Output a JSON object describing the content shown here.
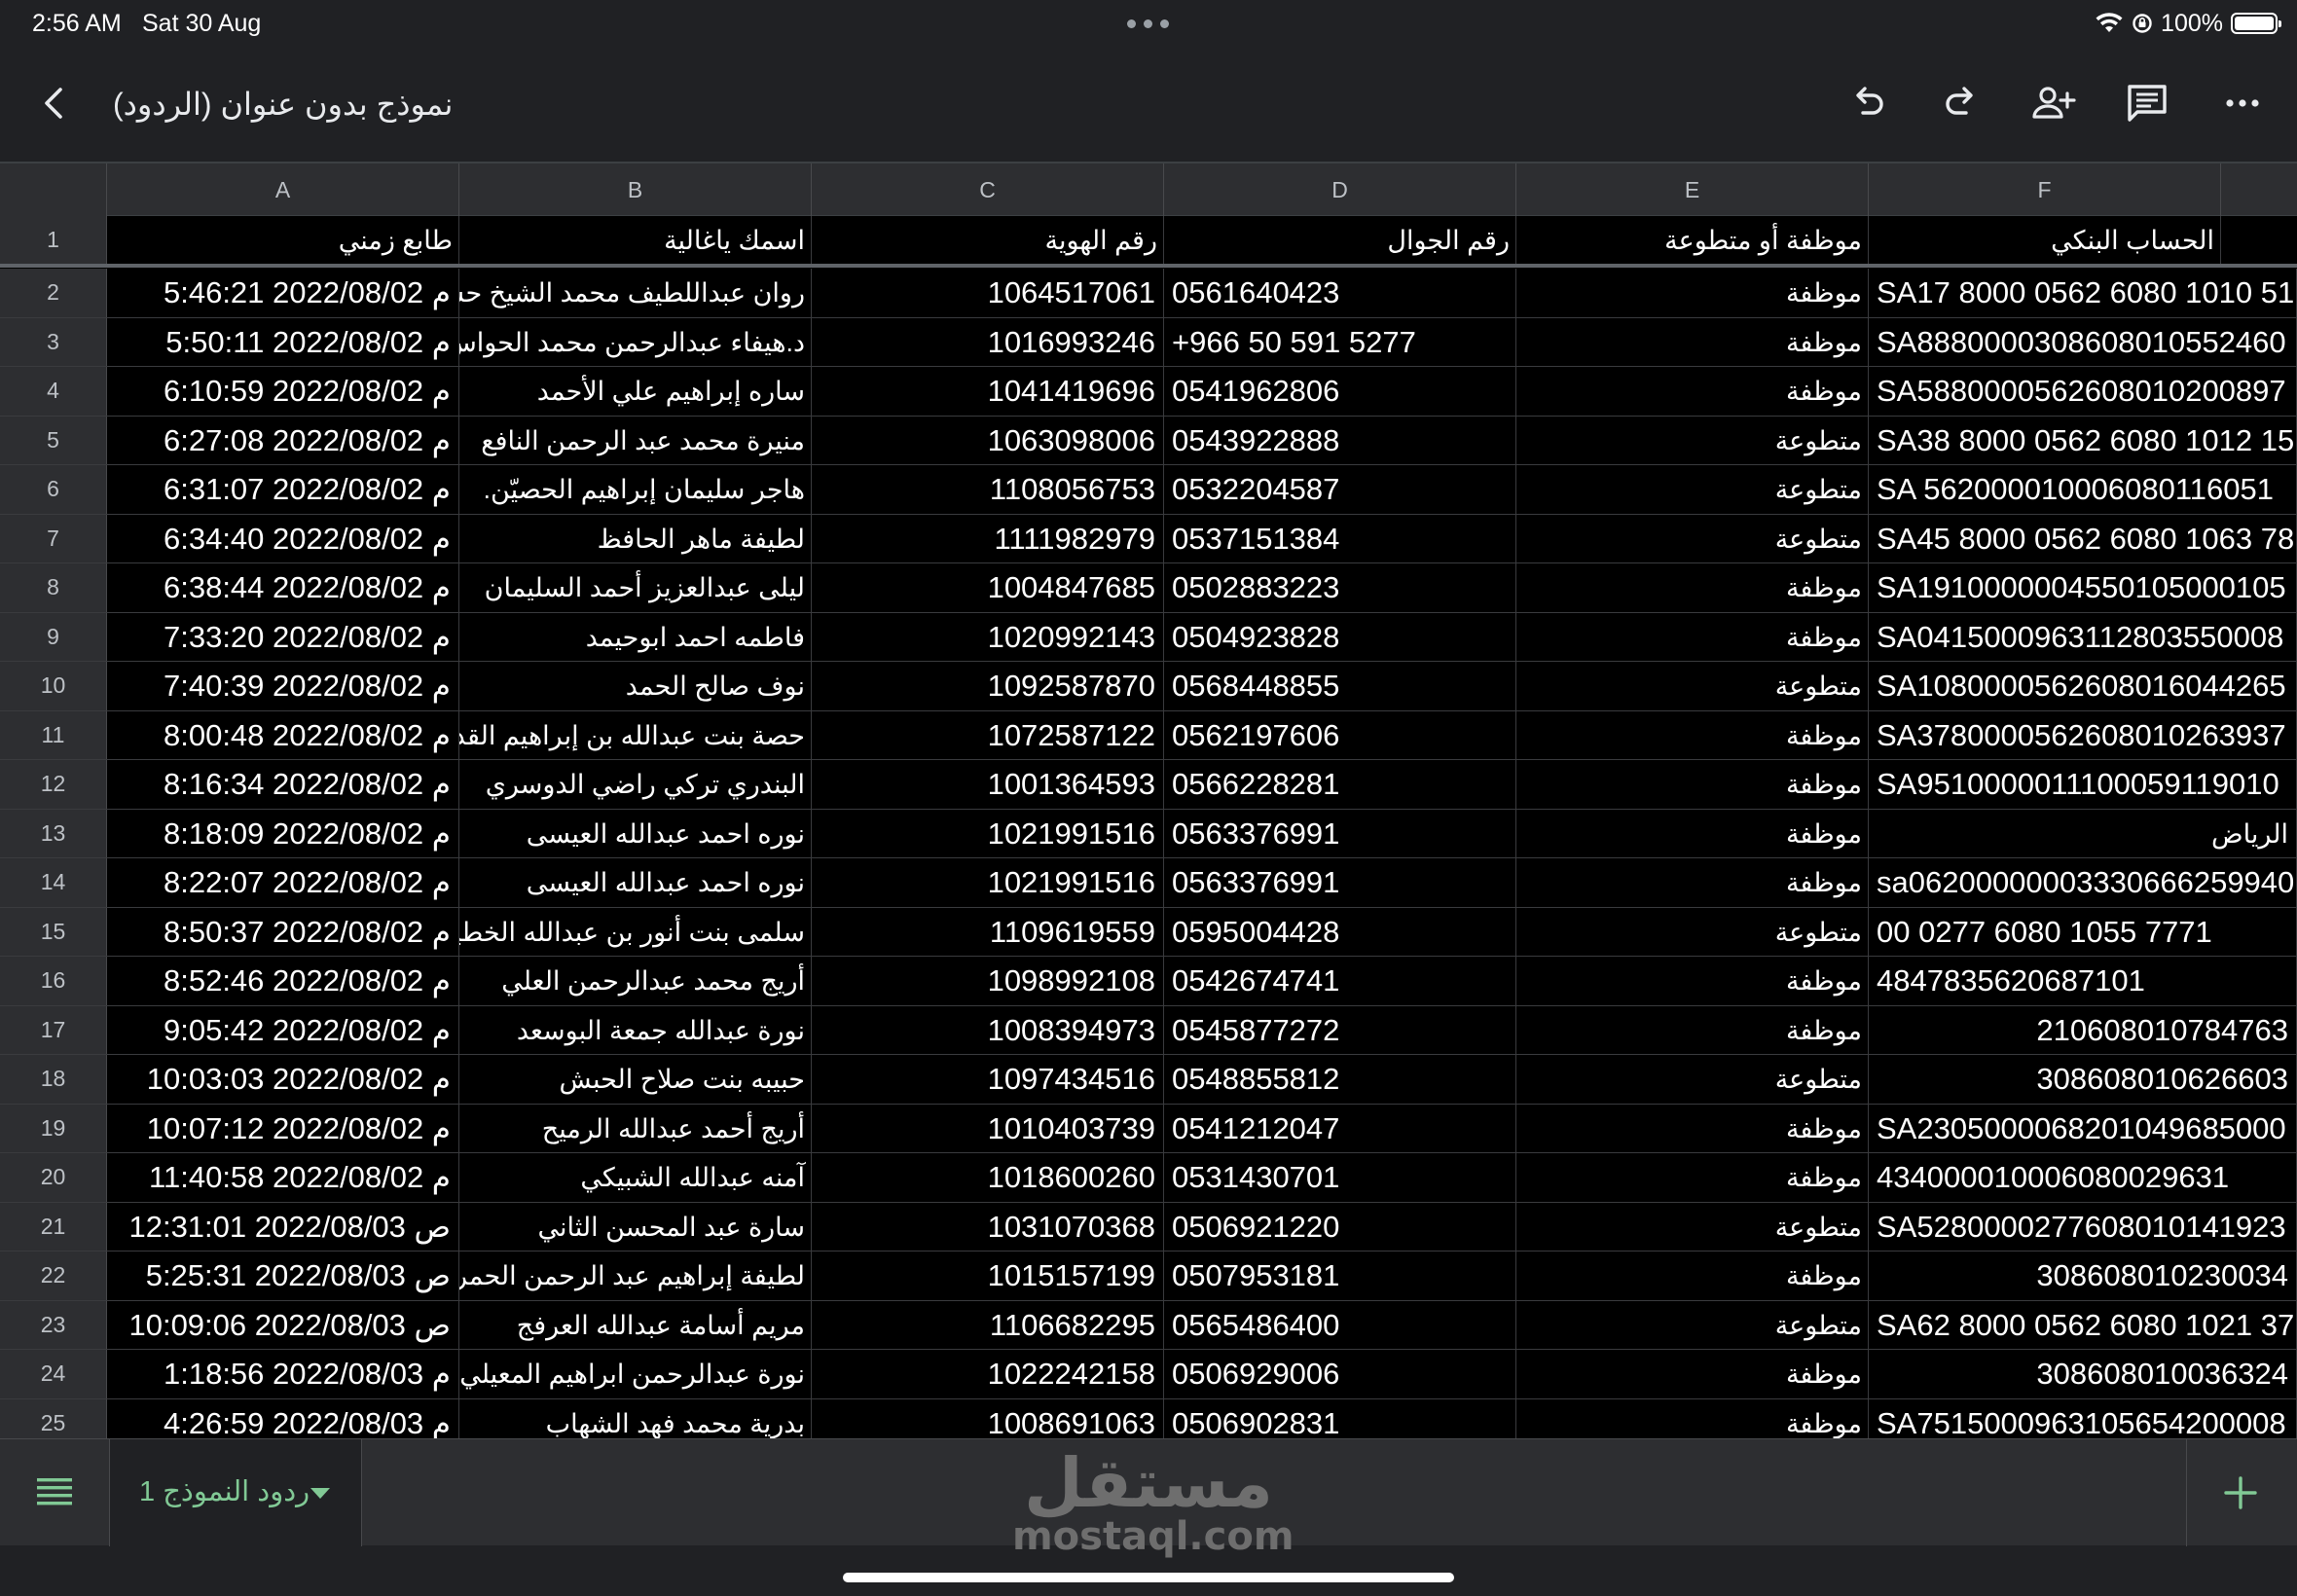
{
  "status": {
    "time": "2:56 AM",
    "date": "Sat 30 Aug",
    "battery": "100%",
    "battery_level": 1.0
  },
  "toolbar": {
    "title": "نموذج بدون عنوان (الردود)"
  },
  "columns": [
    "A",
    "B",
    "C",
    "D",
    "E",
    "F"
  ],
  "header": {
    "num": "1",
    "cells": [
      "طابع زمني",
      "اسمك ياغالية",
      "رقم الهوية",
      "رقم الجوال",
      "موظفة أو متطوعة",
      "الحساب البنكي"
    ]
  },
  "rows": [
    {
      "num": "2",
      "ts": "5:46:21 2022/08/02 م",
      "name": "روان عبداللطيف محمد الشيخ حسين",
      "id": "1064517061",
      "phone": "0561640423",
      "type": "موظفة",
      "acct": "SA17 8000 0562 6080 1010 51",
      "acct_align": "left"
    },
    {
      "num": "3",
      "ts": "5:50:11 2022/08/02 م",
      "name": "د.هيفاء عبدالرحمن محمد الحواس",
      "id": "1016993246",
      "phone": "+966 50 591 5277",
      "type": "موظفة",
      "acct": "SA8880000308608010552460",
      "acct_align": "left"
    },
    {
      "num": "4",
      "ts": "6:10:59 2022/08/02 م",
      "name": "ساره إبراهيم علي الأحمد",
      "id": "1041419696",
      "phone": "0541962806",
      "type": "موظفة",
      "acct": "SA5880000562608010200897",
      "acct_align": "left"
    },
    {
      "num": "5",
      "ts": "6:27:08 2022/08/02 م",
      "name": "منيرة محمد عبد الرحمن النافع",
      "id": "1063098006",
      "phone": "0543922888",
      "type": "متطوعة",
      "acct": "SA38 8000 0562 6080 1012 15",
      "acct_align": "left"
    },
    {
      "num": "6",
      "ts": "6:31:07 2022/08/02 م",
      "name": "هاجر سليمان إبراهيم الحصيّن.",
      "id": "1108056753",
      "phone": "0532204587",
      "type": "متطوعة",
      "acct": "SA 5620000100060801​16051",
      "acct_align": "left"
    },
    {
      "num": "7",
      "ts": "6:34:40 2022/08/02 م",
      "name": "لطيفة ماهر الحافظ",
      "id": "1111982979",
      "phone": "0537151384",
      "type": "متطوعة",
      "acct": "SA45 8000 0562 6080 1063 78",
      "acct_align": "left"
    },
    {
      "num": "8",
      "ts": "6:38:44 2022/08/02 م",
      "name": "ليلى عبدالعزيز أحمد السليمان",
      "id": "1004847685",
      "phone": "0502883223",
      "type": "موظفة",
      "acct": "SA1910000004550105000105",
      "acct_align": "left"
    },
    {
      "num": "9",
      "ts": "7:33:20 2022/08/02 م",
      "name": "فاطمه احمد ابوحيمد",
      "id": "1020992143",
      "phone": "0504923828",
      "type": "موظفة",
      "acct": "SA0415000963112803550008",
      "acct_align": "left"
    },
    {
      "num": "10",
      "ts": "7:40:39 2022/08/02 م",
      "name": "نوف صالح الحمد",
      "id": "1092587870",
      "phone": "0568448855",
      "type": "متطوعة",
      "acct": "SA1080000562608016044265",
      "acct_align": "left"
    },
    {
      "num": "11",
      "ts": "8:00:48 2022/08/02 م",
      "name": "حصة بنت عبدالله  بن إبراهيم القديم",
      "id": "1072587122",
      "phone": "0562197606",
      "type": "موظفة",
      "acct": "SA3780000562608010263937",
      "acct_align": "left"
    },
    {
      "num": "12",
      "ts": "8:16:34 2022/08/02 م",
      "name": "البندري تركي راضي الدوسري",
      "id": "1001364593",
      "phone": "0566228281",
      "type": "موظفة",
      "acct": "SA9510000011100059119010",
      "acct_align": "left"
    },
    {
      "num": "13",
      "ts": "8:18:09 2022/08/02 م",
      "name": "نوره  احمد  عبدالله العيسى",
      "id": "1021991516",
      "phone": "0563376991",
      "type": "موظفة",
      "acct": "الرياض",
      "acct_align": "rtl"
    },
    {
      "num": "14",
      "ts": "8:22:07 2022/08/02 م",
      "name": "نوره احمد عبدالله العيسى",
      "id": "1021991516",
      "phone": "0563376991",
      "type": "موظفة",
      "acct": "sa0620000000333066625994​0",
      "acct_align": "left"
    },
    {
      "num": "15",
      "ts": "8:50:37 2022/08/02 م",
      "name": "سلمى بنت أنور بن عبدالله الخطيب",
      "id": "1109619559",
      "phone": "0595004428",
      "type": "متطوعة",
      "acct": "00 0277 6080 1055 7771",
      "acct_align": "left"
    },
    {
      "num": "16",
      "ts": "8:52:46 2022/08/02 م",
      "name": "أريج محمد عبدالرحمن العلي",
      "id": "1098992108",
      "phone": "0542674741",
      "type": "موظفة",
      "acct": "4847835620687101",
      "acct_align": "left"
    },
    {
      "num": "17",
      "ts": "9:05:42 2022/08/02 م",
      "name": "نورة عبدالله جمعة البوسعد",
      "id": "1008394973",
      "phone": "0545877272",
      "type": "موظفة",
      "acct": "210608010784763",
      "acct_align": "right"
    },
    {
      "num": "18",
      "ts": "10:03:03 2022/08/02 م",
      "name": "حبيبه بنت صلاح الحبش",
      "id": "1097434516",
      "phone": "0548855812",
      "type": "متطوعة",
      "acct": "308608010626603",
      "acct_align": "right"
    },
    {
      "num": "19",
      "ts": "10:07:12 2022/08/02 م",
      "name": "أريج أحمد عبدالله الرميح",
      "id": "1010403739",
      "phone": "0541212047",
      "type": "موظفة",
      "acct": "SA2305000068201049685000",
      "acct_align": "left"
    },
    {
      "num": "20",
      "ts": "11:40:58 2022/08/02 م",
      "name": "آمنه عبدالله الشبيكي",
      "id": "1018600260",
      "phone": "0531430701",
      "type": "موظفة",
      "acct": "434000010006080029631",
      "acct_align": "left"
    },
    {
      "num": "21",
      "ts": "12:31:01 2022/08/03 ص",
      "name": "سارة عبد المحسن الثاني",
      "id": "1031070368",
      "phone": "0506921220",
      "type": "متطوعة",
      "acct": "SA5280000277608010141923",
      "acct_align": "left"
    },
    {
      "num": "22",
      "ts": "5:25:31 2022/08/03 ص",
      "name": "لطيفة إبراهيم عبد الرحمن الحمر",
      "id": "1015157199",
      "phone": "0507953181",
      "type": "موظفة",
      "acct": "308608010230034",
      "acct_align": "right"
    },
    {
      "num": "23",
      "ts": "10:09:06 2022/08/03 ص",
      "name": "مريم أسامة عبدالله العرفج",
      "id": "1106682295",
      "phone": "0565486400",
      "type": "متطوعة",
      "acct": "SA62 8000 0562 6080 1021 37",
      "acct_align": "left"
    },
    {
      "num": "24",
      "ts": "1:18:56 2022/08/03 م",
      "name": "نورة عبدالرحمن ابراهيم المعيلي",
      "id": "1022242158",
      "phone": "0506929006",
      "type": "موظفة",
      "acct": "308608010036324",
      "acct_align": "right"
    },
    {
      "num": "25",
      "ts": "4:26:59 2022/08/03 م",
      "name": "بدرية محمد فهد الشهاب",
      "id": "1008691063",
      "phone": "0506902831",
      "type": "موظفة",
      "acct": "SA7515000963105654200008",
      "acct_align": "left"
    }
  ],
  "bottom": {
    "sheet_tab": "ردود النموذج 1",
    "watermark_ar": "مستقل",
    "watermark_en": "mostaql.com"
  },
  "colors": {
    "background": "#000000",
    "chrome": "#2d2e31",
    "accent": "#81c995"
  }
}
